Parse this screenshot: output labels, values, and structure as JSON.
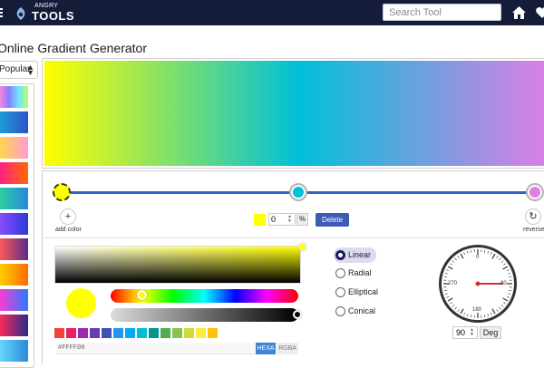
{
  "header": {
    "logo_small": "ANGRY",
    "logo_big": "TOOLS",
    "search_placeholder": "Search Tool"
  },
  "page": {
    "title": "Online Gradient Generator"
  },
  "sidebar": {
    "category_selected": "Popular",
    "presets": [
      "linear-gradient(to right,#ff8ad8,#8a7dff,#6fe3ff,#b7ff6a)",
      "linear-gradient(to right,#1da0d8,#2f50c8)",
      "linear-gradient(to right,#ffd84a,#ff9ecf)",
      "linear-gradient(to right,#ff1e8a,#ff6a00)",
      "linear-gradient(to right,#2ecfa0,#2a86e0)",
      "linear-gradient(to right,#8a4dff,#2a3ad8)",
      "linear-gradient(to right,#ff5a5a,#5a2a8a)",
      "linear-gradient(to right,#ffd200,#ff6a00)",
      "linear-gradient(to right,#ff3bd0,#2a7aff)",
      "linear-gradient(to right,#ff2a5a,#2a2a8a)",
      "linear-gradient(to right,#6ad8ff,#2a8ad8)"
    ]
  },
  "gradient": {
    "type": "Linear",
    "angle_deg": 90,
    "css": "linear-gradient(90deg, #ffff00 0%, #00c0d8 50%, #e07ee6 100%)",
    "stops": [
      {
        "color": "#ffff00",
        "position": 0
      },
      {
        "color": "#00c0d8",
        "position": 50
      },
      {
        "color": "#e07ee6",
        "position": 100
      }
    ]
  },
  "stop_editor": {
    "add_label": "add color",
    "reverse_label": "reverse",
    "selected_color": "#ffff00",
    "position_value": "0",
    "percent_label": "%",
    "delete_label": "Delete"
  },
  "picker": {
    "hex_value": "#FFFF00",
    "hue_fraction": 0.16,
    "alpha_fraction": 1.0,
    "mode_hexa": "HEXA",
    "mode_rgba": "RGBA",
    "palette": [
      "#f44336",
      "#e91e63",
      "#9c27b0",
      "#673ab7",
      "#3f51b5",
      "#2196f3",
      "#03a9f4",
      "#00bcd4",
      "#009688",
      "#4caf50",
      "#8bc34a",
      "#cddc39",
      "#ffeb3b",
      "#ffc107"
    ]
  },
  "gradient_types": [
    {
      "label": "Linear",
      "selected": true
    },
    {
      "label": "Radial",
      "selected": false
    },
    {
      "label": "Elliptical",
      "selected": false
    },
    {
      "label": "Conical",
      "selected": false
    }
  ],
  "dial": {
    "label_top": "0",
    "label_right": "90",
    "label_bottom": "180",
    "label_left": "270",
    "angle_value": "90",
    "unit_label": "Deg"
  }
}
